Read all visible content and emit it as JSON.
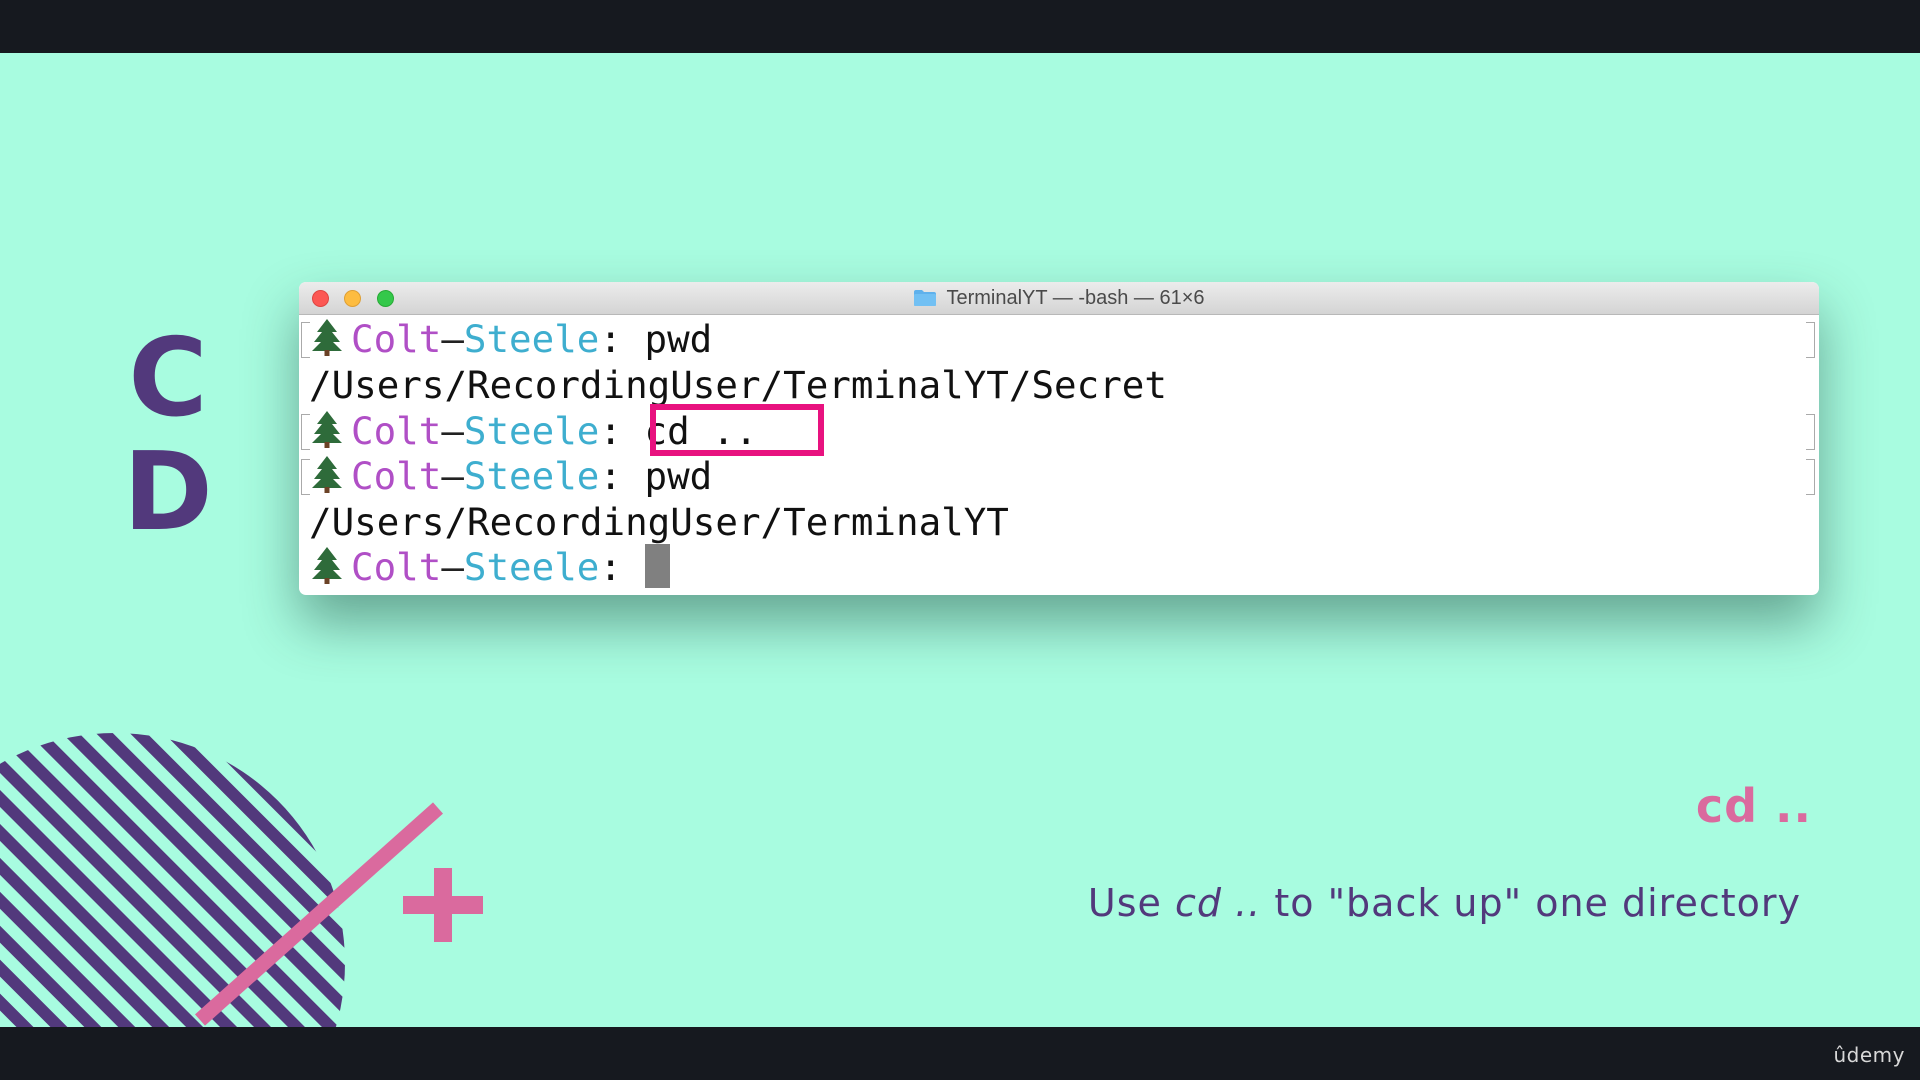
{
  "slide": {
    "letters": [
      "C",
      "D"
    ],
    "heading": "cd ..",
    "caption_before": "Use ",
    "caption_em": "cd ..",
    "caption_after": " to \"back up\" one directory"
  },
  "terminal": {
    "title": "TerminalYT — -bash — 61×6",
    "prompt_user_a": "Colt",
    "prompt_dash": "–",
    "prompt_user_b": "Steele",
    "prompt_colon": ":",
    "lines": [
      {
        "type": "prompt",
        "command": " pwd"
      },
      {
        "type": "output",
        "text": "/Users/RecordingUser/TerminalYT/Secret"
      },
      {
        "type": "prompt",
        "command": " cd .."
      },
      {
        "type": "prompt",
        "command": " pwd"
      },
      {
        "type": "output",
        "text": "/Users/RecordingUser/TerminalYT"
      },
      {
        "type": "prompt",
        "command": " "
      }
    ]
  },
  "branding": {
    "logo_text": "ûdemy"
  },
  "colors": {
    "slide_bg": "#a8fce0",
    "purple": "#52397c",
    "pink": "#da6a9e",
    "highlight": "#e8127f",
    "prompt_purple": "#b04fc6",
    "prompt_cyan": "#3eaecf"
  }
}
